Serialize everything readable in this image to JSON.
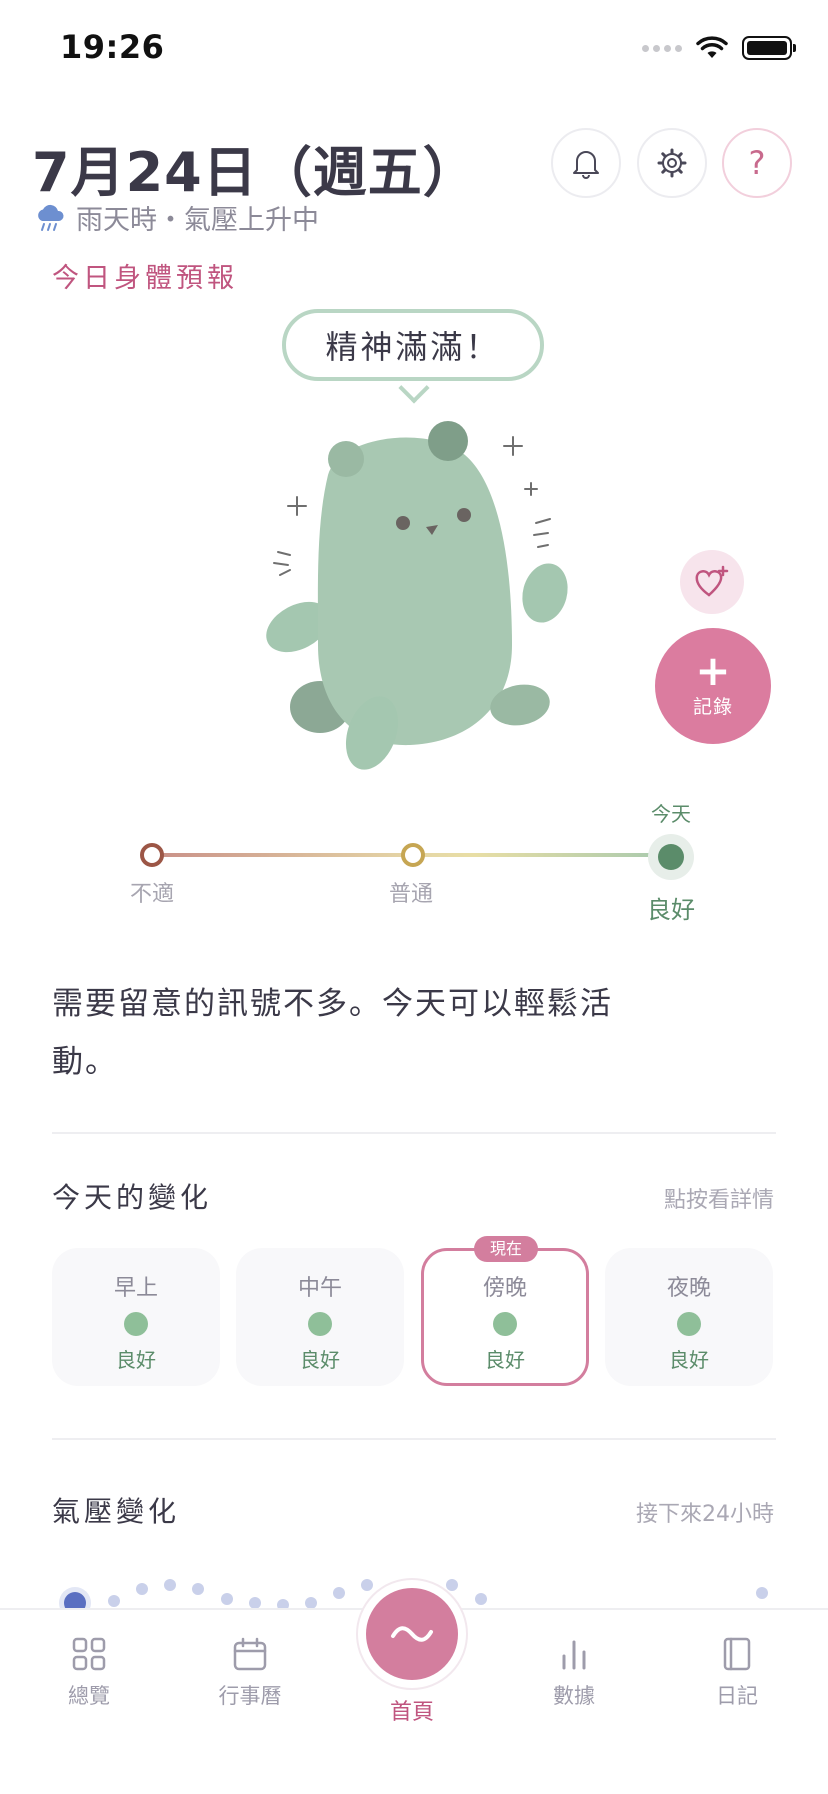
{
  "status_bar": {
    "time": "19:26"
  },
  "header": {
    "date": "7月24日（週五）",
    "weather": "雨天時・氣壓上升中",
    "forecast_title": "今日身體預報"
  },
  "icons": {
    "bell": "bell-icon",
    "settings": "gear-icon",
    "help": "?"
  },
  "mascot": {
    "speech": "精神滿滿！"
  },
  "actions": {
    "record_plus": "+",
    "record_label": "記錄"
  },
  "condition_scale": {
    "today_label": "今天",
    "levels": [
      "不適",
      "普通",
      "良好"
    ],
    "current_level": "良好"
  },
  "summary": "需要留意的訊號不多。今天可以輕鬆活動。",
  "today_changes": {
    "title": "今天的變化",
    "hint": "點按看詳情",
    "now_badge": "現在",
    "periods": [
      {
        "name": "早上",
        "status": "良好"
      },
      {
        "name": "中午",
        "status": "良好"
      },
      {
        "name": "傍晚",
        "status": "良好"
      },
      {
        "name": "夜晚",
        "status": "良好"
      }
    ],
    "active_period": "傍晚"
  },
  "pressure": {
    "title": "氣壓變化",
    "hint": "接下來24小時"
  },
  "tabbar": {
    "tabs": [
      {
        "label": "總覽",
        "icon": "grid-icon"
      },
      {
        "label": "行事曆",
        "icon": "calendar-icon"
      },
      {
        "label": "首頁",
        "icon": "wave-icon"
      },
      {
        "label": "數據",
        "icon": "bar-chart-icon"
      },
      {
        "label": "日記",
        "icon": "notebook-icon"
      }
    ],
    "active": "首頁"
  },
  "colors": {
    "accent_pink": "#d37e9e",
    "good_green": "#5b8c6a",
    "mascot_green": "#a8c8b2",
    "pressure_blue": "#5a6fc1"
  }
}
